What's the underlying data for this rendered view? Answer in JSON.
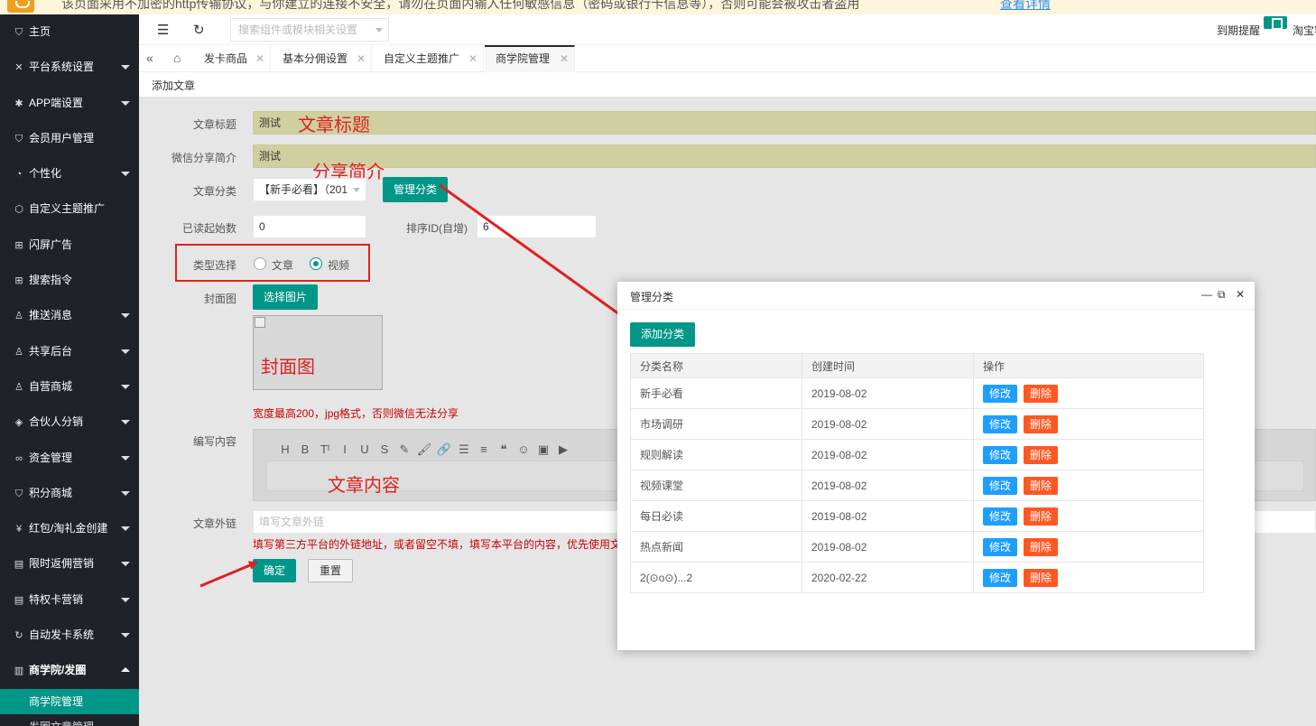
{
  "banner": {
    "text": "该页面采用不加密的http传输协议，与你建立的连接不安全，请勿在页面内输入任何敏感信息（密码或银行卡信息等），否则可能会被攻击者盗用",
    "link": "查看详情"
  },
  "sidebar": {
    "items": [
      {
        "icon": "shield-icon",
        "glyph": "⛉",
        "label": "主页",
        "caret": false
      },
      {
        "icon": "wrench-icon",
        "glyph": "✕",
        "label": "平台系统设置",
        "caret": true
      },
      {
        "icon": "gear-icon",
        "glyph": "✱",
        "label": "APP端设置",
        "caret": true
      },
      {
        "icon": "shield-icon",
        "glyph": "⛉",
        "label": "会员用户管理",
        "caret": false
      },
      {
        "icon": "palette-icon",
        "glyph": "◔",
        "label": "个性化",
        "caret": true
      },
      {
        "icon": "cube-icon",
        "glyph": "⬡",
        "label": "自定义主题推广",
        "caret": false
      },
      {
        "icon": "app-icon",
        "glyph": "⊞",
        "label": "闪屏广告",
        "caret": false
      },
      {
        "icon": "app-icon",
        "glyph": "⊞",
        "label": "搜索指令",
        "caret": false
      },
      {
        "icon": "user-icon",
        "glyph": "♙",
        "label": "推送消息",
        "caret": true
      },
      {
        "icon": "users-icon",
        "glyph": "♙",
        "label": "共享后台",
        "caret": true
      },
      {
        "icon": "user-icon",
        "glyph": "♙",
        "label": "自营商城",
        "caret": true
      },
      {
        "icon": "layers-icon",
        "glyph": "◈",
        "label": "合伙人分销",
        "caret": true
      },
      {
        "icon": "link-icon",
        "glyph": "∞",
        "label": "资金管理",
        "caret": true
      },
      {
        "icon": "shield-icon",
        "glyph": "⛉",
        "label": "积分商城",
        "caret": true
      },
      {
        "icon": "yen-icon",
        "glyph": "¥",
        "label": "红包/淘礼金创建",
        "caret": true
      },
      {
        "icon": "calendar-icon",
        "glyph": "▤",
        "label": "限时返佣营销",
        "caret": true
      },
      {
        "icon": "calendar-icon",
        "glyph": "▤",
        "label": "特权卡营销",
        "caret": true
      },
      {
        "icon": "refresh-icon",
        "glyph": "↻",
        "label": "自动发卡系统",
        "caret": true
      },
      {
        "icon": "book-icon",
        "glyph": "▥",
        "label": "商学院/发圈",
        "caret": true,
        "open": true
      }
    ],
    "subitems": [
      {
        "label": "商学院管理",
        "active": true
      },
      {
        "label": "发圈文章管理",
        "active": false
      }
    ]
  },
  "header": {
    "search_placeholder": "搜索组件或模块相关设置",
    "remind": "到期提醒",
    "shop": "淘宝客"
  },
  "tabs": [
    {
      "label": "发卡商品",
      "active": false
    },
    {
      "label": "基本分佣设置",
      "active": false
    },
    {
      "label": "自定义主题推广",
      "active": false
    },
    {
      "label": "商学院管理",
      "active": true
    }
  ],
  "subhead": "添加文章",
  "form": {
    "title_label": "文章标题",
    "title_value": "测试",
    "share_label": "微信分享简介",
    "share_value": "测试",
    "category_label": "文章分类",
    "category_value": "【新手必看】（201",
    "manage_btn": "管理分类",
    "read_label": "已读起始数",
    "read_value": "0",
    "sort_label": "排序ID(自增)",
    "sort_value": "6",
    "type_label": "类型选择",
    "type_options": [
      "文章",
      "视频"
    ],
    "type_selected": "视频",
    "cover_label": "封面图",
    "cover_btn": "选择图片",
    "cover_hint": "宽度最高200，jpg格式，否则微信无法分享",
    "content_label": "编写内容",
    "link_label": "文章外链",
    "link_placeholder": "填写文章外链",
    "link_hint": "填写第三方平台的外链地址，或者留空不填，填写本平台的内容，优先使用文",
    "confirm_btn": "确定",
    "reset_btn": "重置"
  },
  "editor_tools": [
    "H",
    "B",
    "Tᴵ",
    "I",
    "U",
    "S",
    "✎",
    "🖌",
    "🔗",
    "☰",
    "≡",
    "❝",
    "☺",
    "▣",
    "▶"
  ],
  "annotations": {
    "title": "文章标题",
    "share": "分享简介",
    "cover": "封面图",
    "content": "文章内容"
  },
  "modal": {
    "title": "管理分类",
    "add_btn": "添加分类",
    "columns": [
      "分类名称",
      "创建时间",
      "操作"
    ],
    "edit_label": "修改",
    "delete_label": "删除",
    "rows": [
      {
        "name": "新手必看",
        "date": "2019-08-02"
      },
      {
        "name": "市场调研",
        "date": "2019-08-02"
      },
      {
        "name": "规则解读",
        "date": "2019-08-02"
      },
      {
        "name": "视频课堂",
        "date": "2019-08-02"
      },
      {
        "name": "每日必读",
        "date": "2019-08-02"
      },
      {
        "name": "热点新闻",
        "date": "2019-08-02"
      },
      {
        "name": "2(⊙o⊙)...2",
        "date": "2020-02-22"
      }
    ]
  },
  "colors": {
    "accent": "#009688",
    "sidebar": "#20222a",
    "annotation": "#e02020",
    "edit": "#1e9fff",
    "delete": "#ff5722"
  }
}
